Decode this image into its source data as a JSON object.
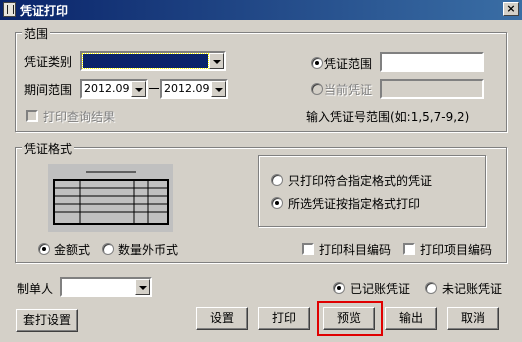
{
  "window": {
    "title": "凭证打印",
    "close_symbol": "×"
  },
  "range_group": {
    "label": "范围",
    "voucher_type_label": "凭证类别",
    "voucher_type_value": "",
    "period_label": "期间范围",
    "period_from": "2012.09",
    "period_to": "2012.09",
    "print_query_label": "打印查询结果",
    "voucher_range_label": "凭证范围",
    "voucher_range_value": "",
    "current_voucher_label": "当前凭证",
    "current_voucher_value": "",
    "hint": "输入凭证号范围(如:1,5,7-9,2)"
  },
  "format_group": {
    "label": "凭证格式",
    "only_matching_label": "只打印符合指定格式的凭证",
    "selected_format_label": "所选凭证按指定格式打印",
    "amount_label": "金额式",
    "foreign_label": "数量外币式",
    "subject_code_label": "打印科目编码",
    "project_code_label": "打印项目编码"
  },
  "maker": {
    "label": "制单人",
    "value": ""
  },
  "posting": {
    "posted_label": "已记账凭证",
    "unposted_label": "未记账凭证"
  },
  "buttons": {
    "template_settings": "套打设置",
    "settings": "设置",
    "print": "打印",
    "preview": "预览",
    "export": "输出",
    "cancel": "取消"
  },
  "colors": {
    "highlight": "#e00000",
    "title_bar": "#0a246a",
    "selection": "#0a246a"
  }
}
